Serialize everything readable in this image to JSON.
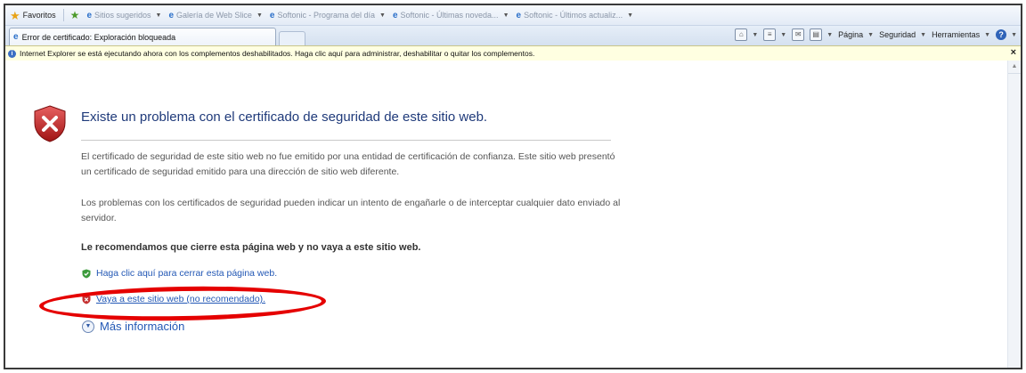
{
  "favorites_bar": {
    "favorites_label": "Favoritos",
    "items": [
      {
        "label": "Sitios sugeridos"
      },
      {
        "label": "Galería de Web Slice"
      },
      {
        "label": "Softonic - Programa del día"
      },
      {
        "label": "Softonic - Últimas noveda..."
      },
      {
        "label": "Softonic - Últimos actualiz..."
      }
    ]
  },
  "tab": {
    "title": "Error de certificado: Exploración bloqueada"
  },
  "command_bar": {
    "page_label": "Página",
    "security_label": "Seguridad",
    "tools_label": "Herramientas"
  },
  "info_bar": {
    "text": "Internet Explorer se está ejecutando ahora con los complementos deshabilitados. Haga clic aquí para administrar, deshabilitar o quitar los complementos."
  },
  "content": {
    "title": "Existe un problema con el certificado de seguridad de este sitio web.",
    "paragraph1": "El certificado de seguridad de este sitio web no fue emitido por una entidad de certificación de confianza. Este sitio web presentó un certificado de seguridad emitido para una dirección de sitio web diferente.",
    "paragraph2": "Los problemas con los certificados de seguridad pueden indicar un intento de engañarle o de interceptar cualquier dato enviado al servidor.",
    "recommendation": "Le recomendamos que cierre esta página web y no vaya a este sitio web.",
    "close_link": "Haga clic aquí para cerrar esta página web.",
    "continue_link": "Vaya a este sitio web (no recomendado).",
    "more_info": "Más información"
  },
  "colors": {
    "highlight_oval": "#e50000",
    "link": "#2358b5",
    "title": "#1f3a7a"
  }
}
